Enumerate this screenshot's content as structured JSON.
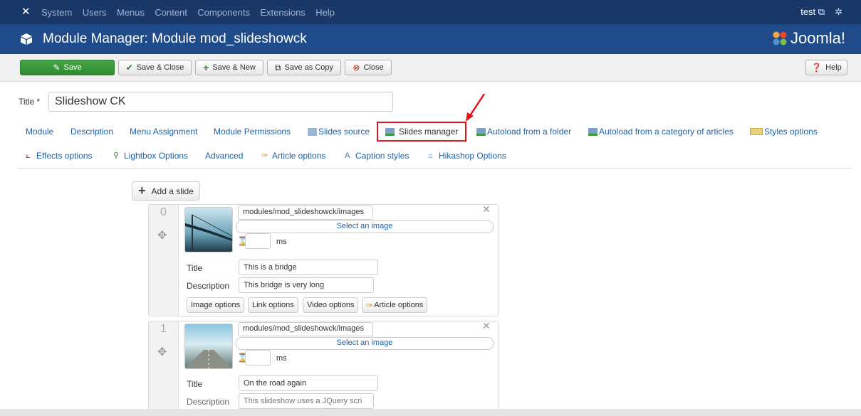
{
  "topbar": {
    "menu": [
      "System",
      "Users",
      "Menus",
      "Content",
      "Components",
      "Extensions",
      "Help"
    ],
    "user": "test",
    "external_icon": "external-link-icon",
    "settings_icon": "gear-icon"
  },
  "header": {
    "title": "Module Manager: Module mod_slideshowck",
    "logo_text": "Joomla!"
  },
  "toolbar": {
    "save": "Save",
    "save_close": "Save & Close",
    "save_new": "Save & New",
    "save_copy": "Save as Copy",
    "close": "Close",
    "help": "Help"
  },
  "form": {
    "title_label": "Title *",
    "title_value": "Slideshow CK"
  },
  "tabs": {
    "module": "Module",
    "description": "Description",
    "menu_assignment": "Menu Assignment",
    "module_permissions": "Module Permissions",
    "slides_source": "Slides source",
    "slides_manager": "Slides manager",
    "autoload_folder": "Autoload from a folder",
    "autoload_category": "Autoload from a category of articles",
    "styles_options": "Styles options",
    "effects_options": "Effects options",
    "lightbox_options": "Lightbox Options",
    "advanced": "Advanced",
    "article_options": "Article options",
    "caption_styles": "Caption styles",
    "hikashop_options": "Hikashop Options"
  },
  "add_slide": "Add a slide",
  "slides": [
    {
      "index": "0",
      "path": "modules/mod_slideshowck/images",
      "select_image": "Select an image",
      "ms_label": "ms",
      "title_label": "Title",
      "title_value": "This is a bridge",
      "description_label": "Description",
      "description_value": "This bridge is very long",
      "buttons": {
        "image_options": "Image options",
        "link_options": "Link options",
        "video_options": "Video options",
        "article_options": "Article options"
      }
    },
    {
      "index": "1",
      "path": "modules/mod_slideshowck/images",
      "select_image": "Select an image",
      "ms_label": "ms",
      "title_label": "Title",
      "title_value": "On the road again",
      "description_label": "Description",
      "description_value": "This slideshow uses a JQuery scri"
    }
  ],
  "colors": {
    "topbar": "#1a3867",
    "header": "#1f4b8a",
    "save_green": "#46a546",
    "link_blue": "#1f62a8",
    "highlight_red": "#e3141b"
  }
}
